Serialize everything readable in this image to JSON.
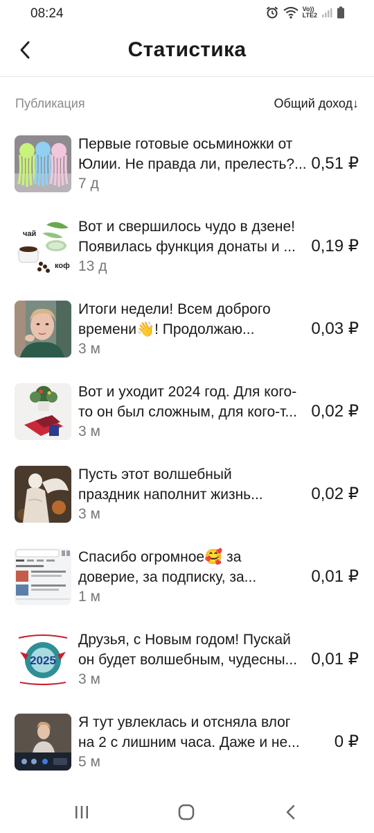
{
  "status_bar": {
    "time": "08:24",
    "icons": [
      "alarm-icon",
      "wifi-icon",
      "volte-lte2-icon",
      "signal-icon",
      "battery-icon"
    ],
    "network_label_top": "Vo))",
    "network_label_bottom": "LTE2"
  },
  "app_bar": {
    "back_icon": "chevron-left-icon",
    "title": "Статистика"
  },
  "list_header": {
    "left_label": "Публикация",
    "right_label": "Общий доход↓"
  },
  "colors": {
    "text_primary": "#1a1a1a",
    "text_secondary": "#777777",
    "header_muted": "#8a8a8a",
    "divider": "#e6e6e6",
    "background": "#ffffff"
  },
  "posts": [
    {
      "line1": "Первые готовые осьминожки от",
      "line2": "Юлии. Не правда ли, прелесть?...",
      "age": "7 д",
      "income": "0,51 ₽",
      "thumb": "crochet-octopus-toys"
    },
    {
      "line1": "Вот и свершилось чудо в дзене!",
      "line2": "Появилась функция донаты и ...",
      "age": "13 д",
      "income": "0,19 ₽",
      "thumb": "tea-coffee-image",
      "thumb_text_1": "чай",
      "thumb_text_2": "коф"
    },
    {
      "line1": "Итоги недели! Всем доброго",
      "line2": "времени👋! Продолжаю...",
      "age": "3 м",
      "income": "0,03 ₽",
      "thumb": "woman-portrait"
    },
    {
      "line1": "Вот и уходит 2024 год. Для кого-",
      "line2": "то он был сложным, для кого-т...",
      "age": "3 м",
      "income": "0,02 ₽",
      "thumb": "new-year-table"
    },
    {
      "line1": "Пусть этот волшебный",
      "line2": "праздник наполнит жизнь...",
      "age": "3 м",
      "income": "0,02 ₽",
      "thumb": "angel-figurine"
    },
    {
      "line1": "Спасибо огромное🥰 за",
      "line2": "доверие, за подписку, за...",
      "age": "1 м",
      "income": "0,01 ₽",
      "thumb": "app-screenshot"
    },
    {
      "line1": "Друзья, с Новым годом! Пускай",
      "line2": "он будет волшебным, чудесны...",
      "age": "3 м",
      "income": "0,01 ₽",
      "thumb": "new-year-2025-card",
      "thumb_text": "2025"
    },
    {
      "line1": "Я тут увлеклась и отсняла влог",
      "line2": "на 2 с лишним часа. Даже и не...",
      "age": "5 м",
      "income": "0 ₽",
      "thumb": "video-call-screen"
    }
  ],
  "nav_bar": {
    "buttons": [
      "recent-apps-icon",
      "home-icon",
      "back-icon"
    ]
  }
}
